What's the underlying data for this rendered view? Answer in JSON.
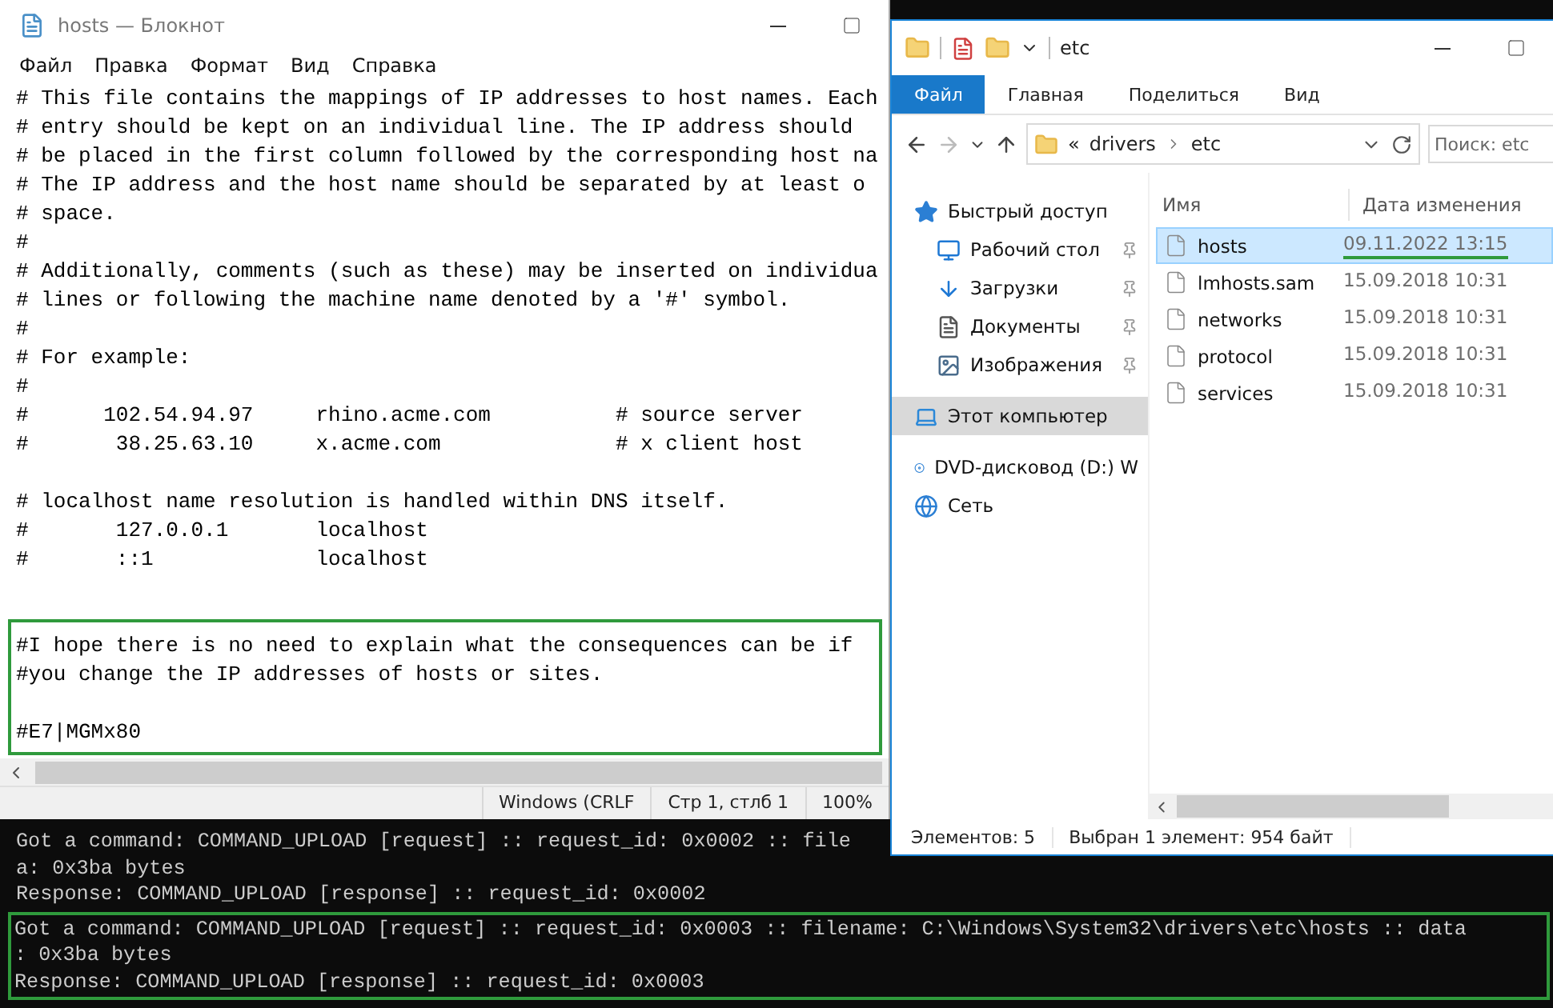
{
  "notepad": {
    "title": "hosts — Блокнот",
    "menu": [
      "Файл",
      "Правка",
      "Формат",
      "Вид",
      "Справка"
    ],
    "blocks": [
      {
        "highlighted": false,
        "paragraphs": [
          [
            "# This file contains the mappings of IP addresses to host names. Each",
            "# entry should be kept on an individual line. The IP address should",
            "# be placed in the first column followed by the corresponding host na",
            "# The IP address and the host name should be separated by at least o",
            "# space.",
            "#",
            "# Additionally, comments (such as these) may be inserted on individua",
            "# lines or following the machine name denoted by a '#' symbol.",
            "#",
            "# For example:",
            "#",
            "#      102.54.94.97     rhino.acme.com          # source server",
            "#       38.25.63.10     x.acme.com              # x client host"
          ],
          [
            "# localhost name resolution is handled within DNS itself.",
            "#       127.0.0.1       localhost",
            "#       ::1             localhost"
          ]
        ]
      },
      {
        "highlighted": true,
        "paragraphs": [
          [
            "#I hope there is no need to explain what the consequences can be if",
            "#you change the IP addresses of hosts or sites."
          ],
          [
            "#E7|MGMx80"
          ]
        ]
      }
    ],
    "status": [
      "Windows (CRLF",
      "Стр 1, стлб 1",
      "100%"
    ]
  },
  "explorer": {
    "title": "etc",
    "ribbon_tabs": [
      {
        "label": "Файл",
        "selected": true
      },
      {
        "label": "Главная",
        "selected": false
      },
      {
        "label": "Поделиться",
        "selected": false
      },
      {
        "label": "Вид",
        "selected": false
      }
    ],
    "path_prefix": "«",
    "path": [
      "drivers",
      "etc"
    ],
    "search": {
      "placeholder": "Поиск: etc"
    },
    "nav": [
      {
        "label": "Быстрый доступ",
        "kind": "quick",
        "pinned": false,
        "selected": false,
        "children": [
          {
            "label": "Рабочий стол",
            "kind": "desktop",
            "pinned": true,
            "selected": false
          },
          {
            "label": "Загрузки",
            "kind": "downloads",
            "pinned": true,
            "selected": false
          },
          {
            "label": "Документы",
            "kind": "documents",
            "pinned": true,
            "selected": false
          },
          {
            "label": "Изображения",
            "kind": "pictures",
            "pinned": true,
            "selected": false
          }
        ]
      },
      {
        "label": "Этот компьютер",
        "kind": "computer",
        "pinned": false,
        "selected": true
      },
      {
        "label": "DVD-дисковод (D:) W",
        "kind": "drive",
        "pinned": false,
        "selected": false
      },
      {
        "label": "Сеть",
        "kind": "network",
        "pinned": false,
        "selected": false
      }
    ],
    "columns": [
      "Имя",
      "Дата изменения"
    ],
    "files": [
      {
        "name": "hosts",
        "modified": "09.11.2022 13:15",
        "selected": true,
        "underlined": true
      },
      {
        "name": "lmhosts.sam",
        "modified": "15.09.2018 10:31",
        "selected": false,
        "underlined": false
      },
      {
        "name": "networks",
        "modified": "15.09.2018 10:31",
        "selected": false,
        "underlined": false
      },
      {
        "name": "protocol",
        "modified": "15.09.2018 10:31",
        "selected": false,
        "underlined": false
      },
      {
        "name": "services",
        "modified": "15.09.2018 10:31",
        "selected": false,
        "underlined": false
      }
    ],
    "status": [
      "Элементов: 5",
      "Выбран 1 элемент: 954 байт"
    ]
  },
  "console": {
    "blocks": [
      {
        "highlighted": false,
        "lines": [
          "Got a command: COMMAND_UPLOAD [request] :: request_id: 0x0002 :: file",
          "a: 0x3ba bytes",
          "Response: COMMAND_UPLOAD [response] :: request_id: 0x0002"
        ]
      },
      {
        "highlighted": true,
        "lines": [
          "Got a command: COMMAND_UPLOAD [request] :: request_id: 0x0003 :: filename: C:\\Windows\\System32\\drivers\\etc\\hosts :: data",
          ": 0x3ba bytes",
          "Response: COMMAND_UPLOAD [response] :: request_id: 0x0003"
        ]
      }
    ]
  }
}
